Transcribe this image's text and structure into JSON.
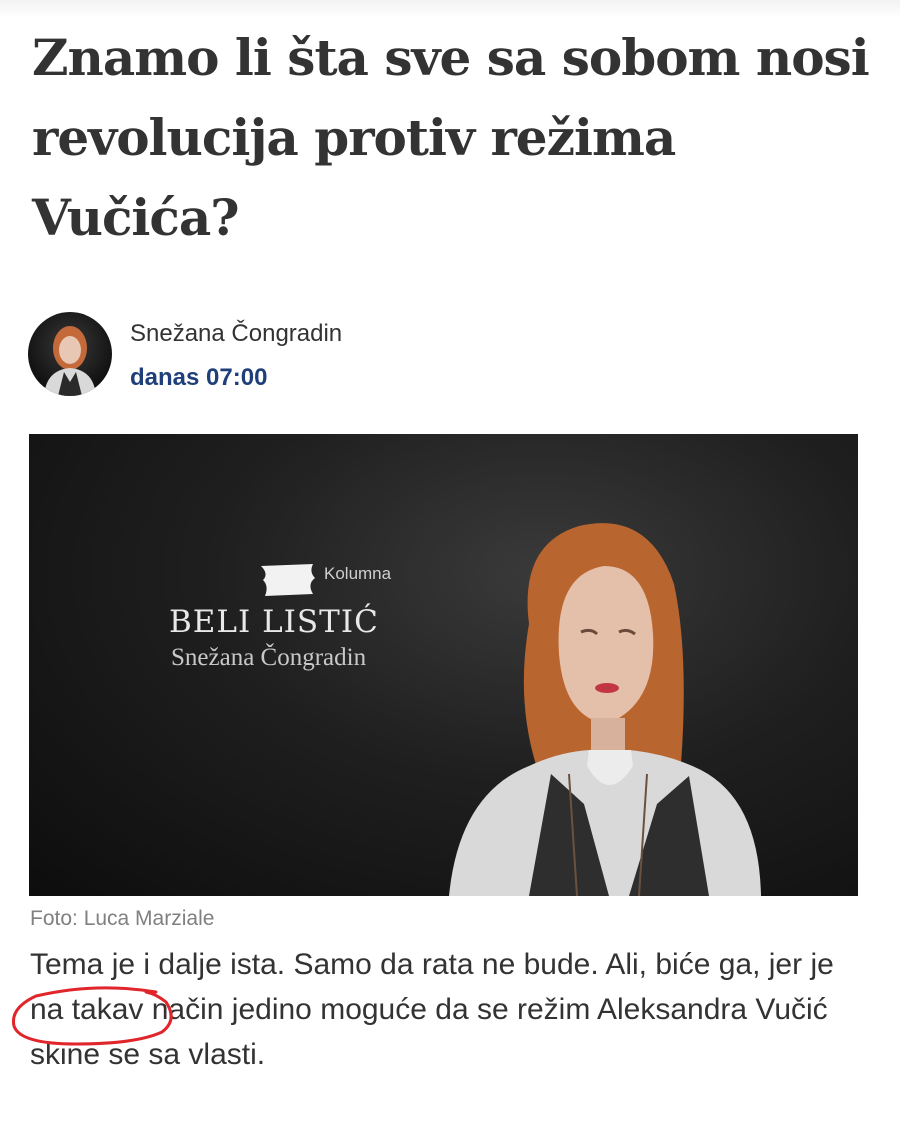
{
  "article": {
    "headline": "Znamo li šta sve sa sobom nosi revolucija protiv režima Vučića?",
    "author": {
      "name": "Snežana Čongradin",
      "date": "danas 07:00"
    },
    "hero": {
      "column_kicker": "Kolumna",
      "column_title": "BELI LISTIĆ",
      "column_author": "Snežana Čongradin"
    },
    "photo_caption": "Foto: Luca Marziale",
    "body": "Tema je i dalje ista. Samo da rata ne bude. Ali, biće ga, jer je na takav način jedino moguće da se režim Aleksandra Vučić skine se sa vlasti."
  },
  "colors": {
    "date_link": "#1f3f7a",
    "annotation": "#e0262b"
  }
}
